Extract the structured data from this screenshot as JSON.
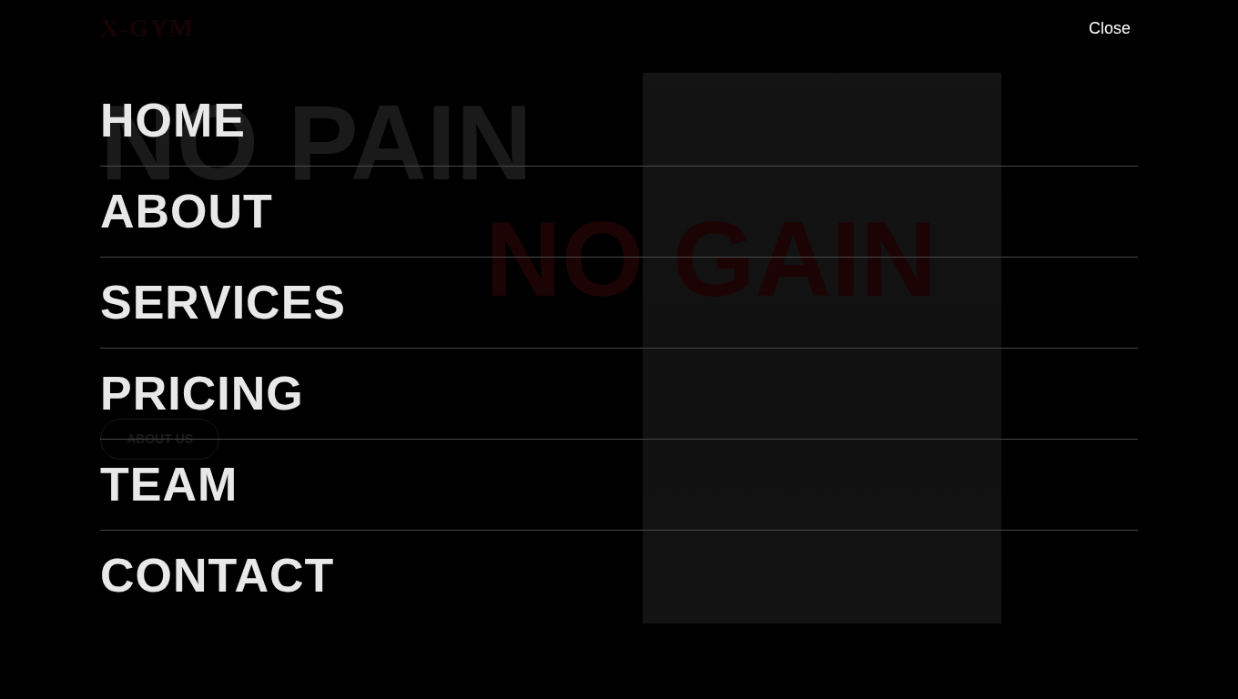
{
  "header": {
    "logo": "X-GYM"
  },
  "hero": {
    "headline_top": "NO PAIN",
    "headline_bottom": "NO GAIN",
    "button": "ABOUT US"
  },
  "menu": {
    "close": "Close",
    "items": [
      {
        "label": "HOME"
      },
      {
        "label": "ABOUT"
      },
      {
        "label": "SERVICES"
      },
      {
        "label": "PRICING"
      },
      {
        "label": "TEAM"
      },
      {
        "label": "CONTACT"
      }
    ]
  }
}
